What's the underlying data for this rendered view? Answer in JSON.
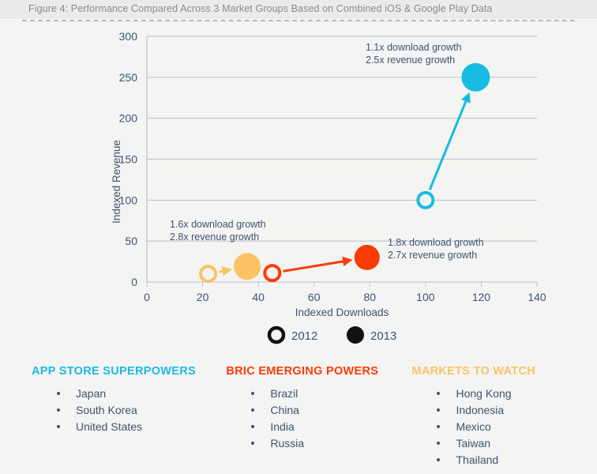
{
  "figure": {
    "caption": "Figure 4: Performance Compared Across 3 Market Groups Based on Combined iOS & Google Play Data"
  },
  "colors": {
    "yellow": "#fac363",
    "red": "#fb3b05",
    "cyan": "#17bce2",
    "text_blue": "#3f5372",
    "grid": "#b7c0d0",
    "background": "#f4f4f2",
    "caption": "#8b8b8b"
  },
  "chart_data": {
    "type": "scatter",
    "title": "",
    "xlabel": "Indexed Downloads",
    "ylabel": "Indexed Revenue",
    "xlim": [
      0,
      140
    ],
    "ylim": [
      0,
      300
    ],
    "xticks": [
      0,
      20,
      40,
      60,
      80,
      100,
      120,
      140
    ],
    "yticks": [
      0,
      50,
      100,
      150,
      200,
      250,
      300
    ],
    "grid": true,
    "legend_position": "bottom-center",
    "legend": [
      {
        "marker": "hollow-circle",
        "label": "2012"
      },
      {
        "marker": "filled-circle",
        "label": "2013"
      }
    ],
    "series": [
      {
        "name": "App Store Superpowers",
        "color": "#fac363",
        "points": [
          {
            "year": "2012",
            "x": 22,
            "y": 10,
            "marker": "hollow-circle",
            "size": 11
          },
          {
            "year": "2013",
            "x": 36,
            "y": 19,
            "marker": "filled-circle",
            "size": 17
          }
        ],
        "annotation": {
          "line1": "1.6x download growth",
          "line2": "2.8x revenue growth"
        }
      },
      {
        "name": "BRIC Emerging Powers",
        "color": "#fb3b05",
        "points": [
          {
            "year": "2012",
            "x": 45,
            "y": 11,
            "marker": "hollow-circle",
            "size": 11
          },
          {
            "year": "2013",
            "x": 79,
            "y": 30,
            "marker": "filled-circle",
            "size": 16
          }
        ],
        "annotation": {
          "line1": "1.8x download growth",
          "line2": "2.7x revenue growth"
        }
      },
      {
        "name": "Markets To Watch",
        "color": "#17bce2",
        "points": [
          {
            "year": "2012",
            "x": 100,
            "y": 100,
            "marker": "hollow-circle",
            "size": 11
          },
          {
            "year": "2013",
            "x": 118,
            "y": 250,
            "marker": "filled-circle",
            "size": 18
          }
        ],
        "annotation": {
          "line1": "1.1x download growth",
          "line2": "2.5x revenue growth"
        }
      }
    ]
  },
  "market_groups": [
    {
      "heading": "APP STORE SUPERPOWERS",
      "color": "#17bce2",
      "items": [
        "Japan",
        "South Korea",
        "United States"
      ]
    },
    {
      "heading": "BRIC EMERGING POWERS",
      "color": "#fb3b05",
      "items": [
        "Brazil",
        "China",
        "India",
        "Russia"
      ]
    },
    {
      "heading": "MARKETS TO WATCH",
      "color": "#fac363",
      "items": [
        "Hong Kong",
        "Indonesia",
        "Mexico",
        "Taiwan",
        "Thailand"
      ]
    }
  ]
}
